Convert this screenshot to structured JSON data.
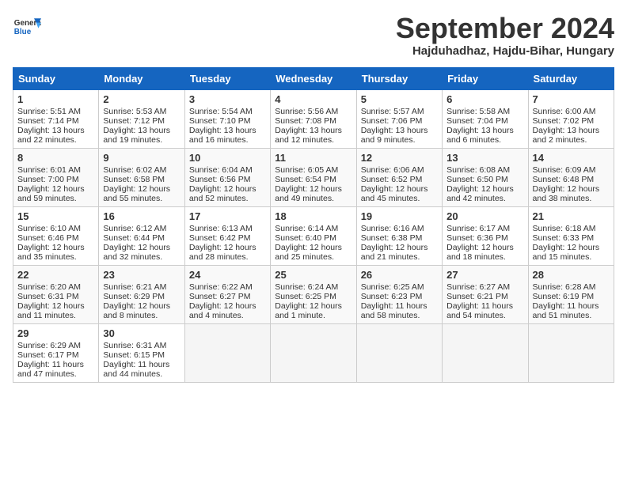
{
  "header": {
    "logo": "GeneralBlue",
    "month": "September 2024",
    "location": "Hajduhadhaz, Hajdu-Bihar, Hungary"
  },
  "days_of_week": [
    "Sunday",
    "Monday",
    "Tuesday",
    "Wednesday",
    "Thursday",
    "Friday",
    "Saturday"
  ],
  "weeks": [
    [
      {
        "day": "1",
        "sunrise": "5:51 AM",
        "sunset": "7:14 PM",
        "daylight": "13 hours and 22 minutes."
      },
      {
        "day": "2",
        "sunrise": "5:53 AM",
        "sunset": "7:12 PM",
        "daylight": "13 hours and 19 minutes."
      },
      {
        "day": "3",
        "sunrise": "5:54 AM",
        "sunset": "7:10 PM",
        "daylight": "13 hours and 16 minutes."
      },
      {
        "day": "4",
        "sunrise": "5:56 AM",
        "sunset": "7:08 PM",
        "daylight": "13 hours and 12 minutes."
      },
      {
        "day": "5",
        "sunrise": "5:57 AM",
        "sunset": "7:06 PM",
        "daylight": "13 hours and 9 minutes."
      },
      {
        "day": "6",
        "sunrise": "5:58 AM",
        "sunset": "7:04 PM",
        "daylight": "13 hours and 6 minutes."
      },
      {
        "day": "7",
        "sunrise": "6:00 AM",
        "sunset": "7:02 PM",
        "daylight": "13 hours and 2 minutes."
      }
    ],
    [
      {
        "day": "8",
        "sunrise": "6:01 AM",
        "sunset": "7:00 PM",
        "daylight": "12 hours and 59 minutes."
      },
      {
        "day": "9",
        "sunrise": "6:02 AM",
        "sunset": "6:58 PM",
        "daylight": "12 hours and 55 minutes."
      },
      {
        "day": "10",
        "sunrise": "6:04 AM",
        "sunset": "6:56 PM",
        "daylight": "12 hours and 52 minutes."
      },
      {
        "day": "11",
        "sunrise": "6:05 AM",
        "sunset": "6:54 PM",
        "daylight": "12 hours and 49 minutes."
      },
      {
        "day": "12",
        "sunrise": "6:06 AM",
        "sunset": "6:52 PM",
        "daylight": "12 hours and 45 minutes."
      },
      {
        "day": "13",
        "sunrise": "6:08 AM",
        "sunset": "6:50 PM",
        "daylight": "12 hours and 42 minutes."
      },
      {
        "day": "14",
        "sunrise": "6:09 AM",
        "sunset": "6:48 PM",
        "daylight": "12 hours and 38 minutes."
      }
    ],
    [
      {
        "day": "15",
        "sunrise": "6:10 AM",
        "sunset": "6:46 PM",
        "daylight": "12 hours and 35 minutes."
      },
      {
        "day": "16",
        "sunrise": "6:12 AM",
        "sunset": "6:44 PM",
        "daylight": "12 hours and 32 minutes."
      },
      {
        "day": "17",
        "sunrise": "6:13 AM",
        "sunset": "6:42 PM",
        "daylight": "12 hours and 28 minutes."
      },
      {
        "day": "18",
        "sunrise": "6:14 AM",
        "sunset": "6:40 PM",
        "daylight": "12 hours and 25 minutes."
      },
      {
        "day": "19",
        "sunrise": "6:16 AM",
        "sunset": "6:38 PM",
        "daylight": "12 hours and 21 minutes."
      },
      {
        "day": "20",
        "sunrise": "6:17 AM",
        "sunset": "6:36 PM",
        "daylight": "12 hours and 18 minutes."
      },
      {
        "day": "21",
        "sunrise": "6:18 AM",
        "sunset": "6:33 PM",
        "daylight": "12 hours and 15 minutes."
      }
    ],
    [
      {
        "day": "22",
        "sunrise": "6:20 AM",
        "sunset": "6:31 PM",
        "daylight": "12 hours and 11 minutes."
      },
      {
        "day": "23",
        "sunrise": "6:21 AM",
        "sunset": "6:29 PM",
        "daylight": "12 hours and 8 minutes."
      },
      {
        "day": "24",
        "sunrise": "6:22 AM",
        "sunset": "6:27 PM",
        "daylight": "12 hours and 4 minutes."
      },
      {
        "day": "25",
        "sunrise": "6:24 AM",
        "sunset": "6:25 PM",
        "daylight": "12 hours and 1 minute."
      },
      {
        "day": "26",
        "sunrise": "6:25 AM",
        "sunset": "6:23 PM",
        "daylight": "11 hours and 58 minutes."
      },
      {
        "day": "27",
        "sunrise": "6:27 AM",
        "sunset": "6:21 PM",
        "daylight": "11 hours and 54 minutes."
      },
      {
        "day": "28",
        "sunrise": "6:28 AM",
        "sunset": "6:19 PM",
        "daylight": "11 hours and 51 minutes."
      }
    ],
    [
      {
        "day": "29",
        "sunrise": "6:29 AM",
        "sunset": "6:17 PM",
        "daylight": "11 hours and 47 minutes."
      },
      {
        "day": "30",
        "sunrise": "6:31 AM",
        "sunset": "6:15 PM",
        "daylight": "11 hours and 44 minutes."
      },
      null,
      null,
      null,
      null,
      null
    ]
  ],
  "labels": {
    "sunrise": "Sunrise:",
    "sunset": "Sunset:",
    "daylight": "Daylight:"
  }
}
